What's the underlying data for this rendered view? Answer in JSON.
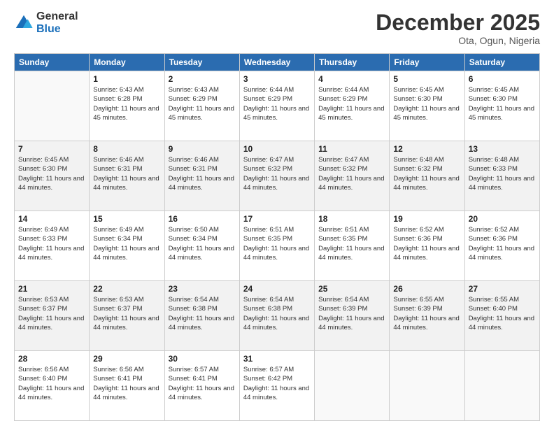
{
  "logo": {
    "general": "General",
    "blue": "Blue"
  },
  "header": {
    "month": "December 2025",
    "location": "Ota, Ogun, Nigeria"
  },
  "days_of_week": [
    "Sunday",
    "Monday",
    "Tuesday",
    "Wednesday",
    "Thursday",
    "Friday",
    "Saturday"
  ],
  "weeks": [
    [
      {
        "day": "",
        "sunrise": "",
        "sunset": "",
        "daylight": ""
      },
      {
        "day": "1",
        "sunrise": "Sunrise: 6:43 AM",
        "sunset": "Sunset: 6:28 PM",
        "daylight": "Daylight: 11 hours and 45 minutes."
      },
      {
        "day": "2",
        "sunrise": "Sunrise: 6:43 AM",
        "sunset": "Sunset: 6:29 PM",
        "daylight": "Daylight: 11 hours and 45 minutes."
      },
      {
        "day": "3",
        "sunrise": "Sunrise: 6:44 AM",
        "sunset": "Sunset: 6:29 PM",
        "daylight": "Daylight: 11 hours and 45 minutes."
      },
      {
        "day": "4",
        "sunrise": "Sunrise: 6:44 AM",
        "sunset": "Sunset: 6:29 PM",
        "daylight": "Daylight: 11 hours and 45 minutes."
      },
      {
        "day": "5",
        "sunrise": "Sunrise: 6:45 AM",
        "sunset": "Sunset: 6:30 PM",
        "daylight": "Daylight: 11 hours and 45 minutes."
      },
      {
        "day": "6",
        "sunrise": "Sunrise: 6:45 AM",
        "sunset": "Sunset: 6:30 PM",
        "daylight": "Daylight: 11 hours and 45 minutes."
      }
    ],
    [
      {
        "day": "7",
        "sunrise": "Sunrise: 6:45 AM",
        "sunset": "Sunset: 6:30 PM",
        "daylight": "Daylight: 11 hours and 44 minutes."
      },
      {
        "day": "8",
        "sunrise": "Sunrise: 6:46 AM",
        "sunset": "Sunset: 6:31 PM",
        "daylight": "Daylight: 11 hours and 44 minutes."
      },
      {
        "day": "9",
        "sunrise": "Sunrise: 6:46 AM",
        "sunset": "Sunset: 6:31 PM",
        "daylight": "Daylight: 11 hours and 44 minutes."
      },
      {
        "day": "10",
        "sunrise": "Sunrise: 6:47 AM",
        "sunset": "Sunset: 6:32 PM",
        "daylight": "Daylight: 11 hours and 44 minutes."
      },
      {
        "day": "11",
        "sunrise": "Sunrise: 6:47 AM",
        "sunset": "Sunset: 6:32 PM",
        "daylight": "Daylight: 11 hours and 44 minutes."
      },
      {
        "day": "12",
        "sunrise": "Sunrise: 6:48 AM",
        "sunset": "Sunset: 6:32 PM",
        "daylight": "Daylight: 11 hours and 44 minutes."
      },
      {
        "day": "13",
        "sunrise": "Sunrise: 6:48 AM",
        "sunset": "Sunset: 6:33 PM",
        "daylight": "Daylight: 11 hours and 44 minutes."
      }
    ],
    [
      {
        "day": "14",
        "sunrise": "Sunrise: 6:49 AM",
        "sunset": "Sunset: 6:33 PM",
        "daylight": "Daylight: 11 hours and 44 minutes."
      },
      {
        "day": "15",
        "sunrise": "Sunrise: 6:49 AM",
        "sunset": "Sunset: 6:34 PM",
        "daylight": "Daylight: 11 hours and 44 minutes."
      },
      {
        "day": "16",
        "sunrise": "Sunrise: 6:50 AM",
        "sunset": "Sunset: 6:34 PM",
        "daylight": "Daylight: 11 hours and 44 minutes."
      },
      {
        "day": "17",
        "sunrise": "Sunrise: 6:51 AM",
        "sunset": "Sunset: 6:35 PM",
        "daylight": "Daylight: 11 hours and 44 minutes."
      },
      {
        "day": "18",
        "sunrise": "Sunrise: 6:51 AM",
        "sunset": "Sunset: 6:35 PM",
        "daylight": "Daylight: 11 hours and 44 minutes."
      },
      {
        "day": "19",
        "sunrise": "Sunrise: 6:52 AM",
        "sunset": "Sunset: 6:36 PM",
        "daylight": "Daylight: 11 hours and 44 minutes."
      },
      {
        "day": "20",
        "sunrise": "Sunrise: 6:52 AM",
        "sunset": "Sunset: 6:36 PM",
        "daylight": "Daylight: 11 hours and 44 minutes."
      }
    ],
    [
      {
        "day": "21",
        "sunrise": "Sunrise: 6:53 AM",
        "sunset": "Sunset: 6:37 PM",
        "daylight": "Daylight: 11 hours and 44 minutes."
      },
      {
        "day": "22",
        "sunrise": "Sunrise: 6:53 AM",
        "sunset": "Sunset: 6:37 PM",
        "daylight": "Daylight: 11 hours and 44 minutes."
      },
      {
        "day": "23",
        "sunrise": "Sunrise: 6:54 AM",
        "sunset": "Sunset: 6:38 PM",
        "daylight": "Daylight: 11 hours and 44 minutes."
      },
      {
        "day": "24",
        "sunrise": "Sunrise: 6:54 AM",
        "sunset": "Sunset: 6:38 PM",
        "daylight": "Daylight: 11 hours and 44 minutes."
      },
      {
        "day": "25",
        "sunrise": "Sunrise: 6:54 AM",
        "sunset": "Sunset: 6:39 PM",
        "daylight": "Daylight: 11 hours and 44 minutes."
      },
      {
        "day": "26",
        "sunrise": "Sunrise: 6:55 AM",
        "sunset": "Sunset: 6:39 PM",
        "daylight": "Daylight: 11 hours and 44 minutes."
      },
      {
        "day": "27",
        "sunrise": "Sunrise: 6:55 AM",
        "sunset": "Sunset: 6:40 PM",
        "daylight": "Daylight: 11 hours and 44 minutes."
      }
    ],
    [
      {
        "day": "28",
        "sunrise": "Sunrise: 6:56 AM",
        "sunset": "Sunset: 6:40 PM",
        "daylight": "Daylight: 11 hours and 44 minutes."
      },
      {
        "day": "29",
        "sunrise": "Sunrise: 6:56 AM",
        "sunset": "Sunset: 6:41 PM",
        "daylight": "Daylight: 11 hours and 44 minutes."
      },
      {
        "day": "30",
        "sunrise": "Sunrise: 6:57 AM",
        "sunset": "Sunset: 6:41 PM",
        "daylight": "Daylight: 11 hours and 44 minutes."
      },
      {
        "day": "31",
        "sunrise": "Sunrise: 6:57 AM",
        "sunset": "Sunset: 6:42 PM",
        "daylight": "Daylight: 11 hours and 44 minutes."
      },
      {
        "day": "",
        "sunrise": "",
        "sunset": "",
        "daylight": ""
      },
      {
        "day": "",
        "sunrise": "",
        "sunset": "",
        "daylight": ""
      },
      {
        "day": "",
        "sunrise": "",
        "sunset": "",
        "daylight": ""
      }
    ]
  ]
}
